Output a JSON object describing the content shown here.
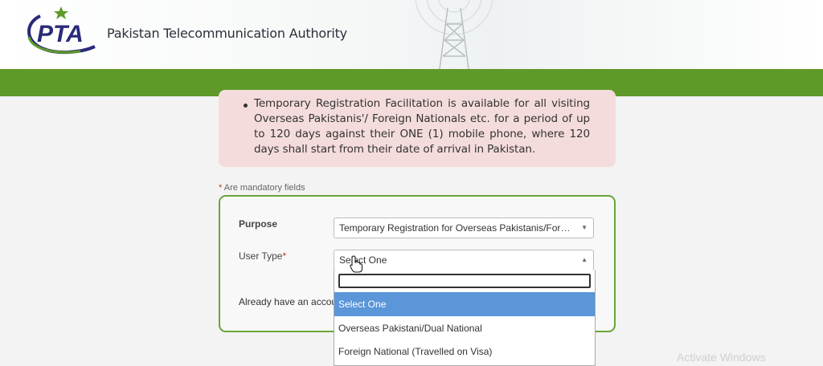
{
  "header": {
    "logo_text": "PTA",
    "organization_name": "Pakistan Telecommunication Authority",
    "brand_blue": "#2a2a7a",
    "brand_green": "#5f9a28"
  },
  "notice": {
    "text": "Temporary Registration Facilitation is available for all visiting Overseas Pakistanis'/ Foreign Nationals etc. for a period of up to 120 days against their ONE (1) mobile phone, where 120 days shall start from their date of arrival in Pakistan.",
    "background": "#f5dcdc"
  },
  "form": {
    "mandatory_star": "*",
    "mandatory_note": "Are mandatory fields",
    "purpose_label": "Purpose",
    "purpose_value": "Temporary Registration for Overseas Pakistanis/Foreig...",
    "user_type_label": "User Type",
    "user_type_required": "*",
    "user_type_value": "Select One",
    "account_text": "Already have an accou",
    "border_color": "#6aa43a"
  },
  "dropdown": {
    "search_value": "",
    "options": [
      "Select One",
      "Overseas Pakistani/Dual National",
      "Foreign National (Travelled on Visa)"
    ],
    "highlight_color": "#5b96d9"
  },
  "icons": {
    "dropdown_closed_arrow": "▼",
    "dropdown_open_arrow": "▲",
    "cursor": "hand-pointer-icon"
  },
  "watermark": "Activate Windows"
}
